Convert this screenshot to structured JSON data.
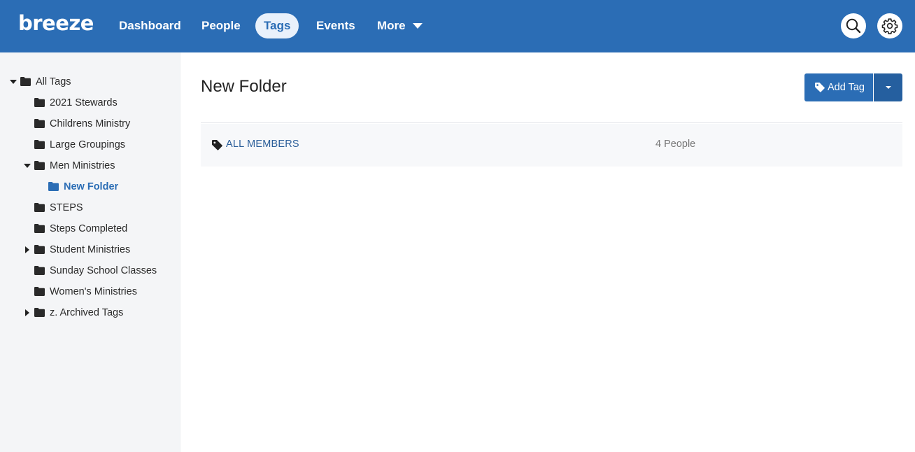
{
  "app": {
    "logo": "breeze"
  },
  "nav": {
    "items": [
      {
        "label": "Dashboard"
      },
      {
        "label": "People"
      },
      {
        "label": "Tags"
      },
      {
        "label": "Events"
      },
      {
        "label": "More"
      }
    ],
    "active": "Tags"
  },
  "header_actions": {
    "search_icon": "search-icon",
    "settings_icon": "gear-icon"
  },
  "sidebar": {
    "tree": [
      {
        "label": "All Tags",
        "expanded": true
      },
      {
        "label": "2021 Stewards"
      },
      {
        "label": "Childrens Ministry"
      },
      {
        "label": "Large Groupings"
      },
      {
        "label": "Men Ministries",
        "expanded": true
      },
      {
        "label": "New Folder",
        "selected": true
      },
      {
        "label": "STEPS"
      },
      {
        "label": "Steps Completed"
      },
      {
        "label": "Student Ministries",
        "expanded": false
      },
      {
        "label": "Sunday School Classes"
      },
      {
        "label": "Women's Ministries"
      },
      {
        "label": "z. Archived Tags",
        "expanded": false
      }
    ]
  },
  "main": {
    "title": "New Folder",
    "add_button_label": "Add Tag",
    "tags": [
      {
        "name": "ALL MEMBERS",
        "count": "4 People"
      }
    ]
  },
  "colors": {
    "brand": "#2b6db5",
    "sidebar_bg": "#f4f5f7",
    "link": "#2b5e99"
  }
}
